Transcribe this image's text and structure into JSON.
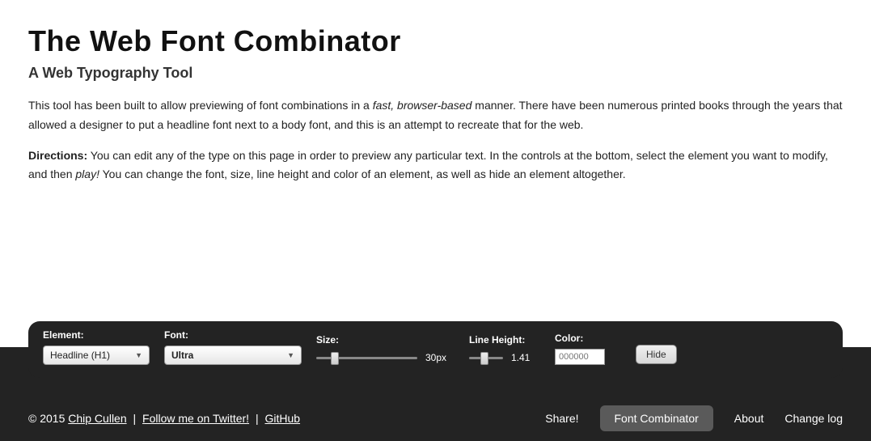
{
  "headline": "The Web Font Combinator",
  "subheadline": "A Web Typography Tool",
  "body1_pre": "This tool has been built to allow previewing of font combinations in a ",
  "body1_italic": "fast, browser-based",
  "body1_post": " manner. There have been numerous printed books through the years that allowed a designer to put a headline font next to a body font, and this is an attempt to recreate that for the web.",
  "body2_bold": "Directions:",
  "body2_pre": " You can edit any of the type on this page in order to preview any particular text. In the controls at the bottom, select the element you want to modify, and then ",
  "body2_italic": "play!",
  "body2_post": " You can change the font, size, line height and color of an element, as well as hide an element altogether.",
  "controls": {
    "element_label": "Element:",
    "element_value": "Headline (H1)",
    "font_label": "Font:",
    "font_value": "Ultra",
    "size_label": "Size:",
    "size_value": "30px",
    "lineheight_label": "Line Height:",
    "lineheight_value": "1.41",
    "color_label": "Color:",
    "color_placeholder": "000000",
    "hide_label": "Hide"
  },
  "footer": {
    "copyright": "© 2015 ",
    "author": "Chip Cullen",
    "sep": " | ",
    "twitter": "Follow me on Twitter!",
    "github": "GitHub",
    "share": "Share!",
    "combinator": "Font Combinator",
    "about": "About",
    "changelog": "Change log"
  }
}
